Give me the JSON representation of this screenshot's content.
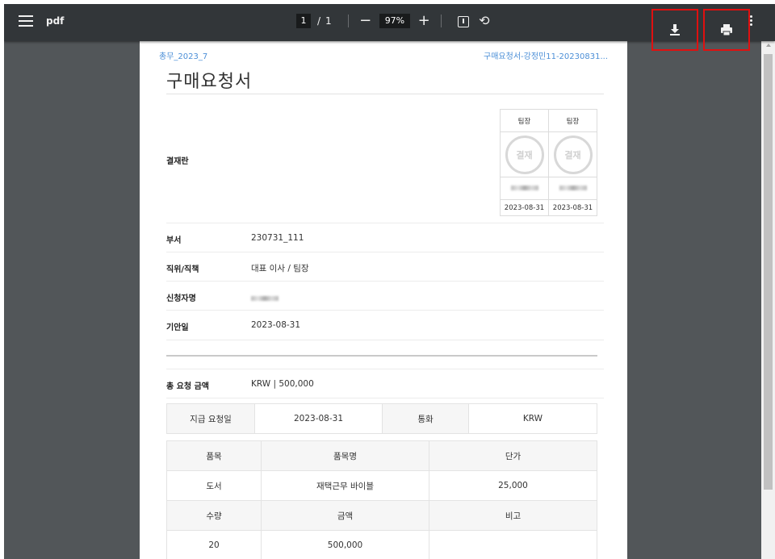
{
  "toolbar": {
    "title": "pdf",
    "page_current": "1",
    "page_separator": "/",
    "page_total": "1",
    "zoom_out": "−",
    "zoom_level": "97%",
    "zoom_in": "+",
    "rotate_glyph": "⟲"
  },
  "doc": {
    "header_left": "총무_2023_7",
    "header_right": "구매요청서-강정민11-20230831...",
    "title": "구매요청서",
    "approval_label": "결재란",
    "approvers": [
      {
        "role": "팀장",
        "stamp": "결재",
        "date": "2023-08-31"
      },
      {
        "role": "팀장",
        "stamp": "결재",
        "date": "2023-08-31"
      }
    ],
    "fields": {
      "dept_label": "부서",
      "dept_value": "230731_111",
      "position_label": "직위/직책",
      "position_value": "대표 이사 / 팀장",
      "applicant_label": "신청자명",
      "draft_date_label": "기안일",
      "draft_date_value": "2023-08-31",
      "total_label": "총 요청 금액",
      "total_value": "KRW | 500,000"
    },
    "payment": {
      "date_label": "지급 요청일",
      "date_value": "2023-08-31",
      "currency_label": "통화",
      "currency_value": "KRW"
    },
    "items": {
      "headers": [
        "품목",
        "품목명",
        "단가"
      ],
      "row1": [
        "도서",
        "재택근무 바이블",
        "25,000"
      ],
      "headers2": [
        "수량",
        "금액",
        "비고"
      ],
      "row2": [
        "20",
        "500,000",
        ""
      ]
    }
  }
}
